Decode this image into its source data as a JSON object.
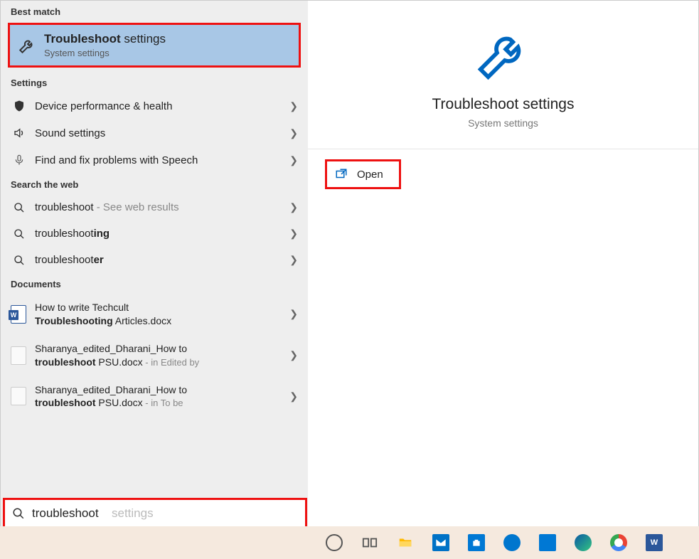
{
  "left": {
    "best_match_header": "Best match",
    "best_match": {
      "title_bold": "Troubleshoot",
      "title_rest": " settings",
      "subtitle": "System settings"
    },
    "settings_header": "Settings",
    "settings_items": [
      {
        "label": "Device performance & health"
      },
      {
        "label": "Sound settings"
      },
      {
        "label": "Find and fix problems with Speech"
      }
    ],
    "web_header": "Search the web",
    "web_items": [
      {
        "prefix": "troubleshoot",
        "bold": "",
        "tail": " - See web results"
      },
      {
        "prefix": "troubleshoot",
        "bold": "ing",
        "tail": ""
      },
      {
        "prefix": "troubleshoot",
        "bold": "er",
        "tail": ""
      }
    ],
    "documents_header": "Documents",
    "docs": [
      {
        "line1": "How to write Techcult ",
        "bold": "Troubleshooting",
        "line2_rest": " Articles.docx",
        "meta": ""
      },
      {
        "line1": "Sharanya_edited_Dharani_How to ",
        "bold": "troubleshoot",
        "line2_rest": " PSU.docx",
        "meta": " - in Edited by"
      },
      {
        "line1": "Sharanya_edited_Dharani_How to ",
        "bold": "troubleshoot",
        "line2_rest": " PSU.docx",
        "meta": " - in To be"
      }
    ]
  },
  "right": {
    "title": "Troubleshoot settings",
    "subtitle": "System settings",
    "open_label": "Open"
  },
  "search": {
    "value": "troubleshoot",
    "hint": "settings"
  },
  "taskbar": {
    "items": [
      "cortana",
      "task-view",
      "file-explorer",
      "mail",
      "store",
      "dell",
      "connect",
      "edge",
      "chrome",
      "word"
    ]
  }
}
